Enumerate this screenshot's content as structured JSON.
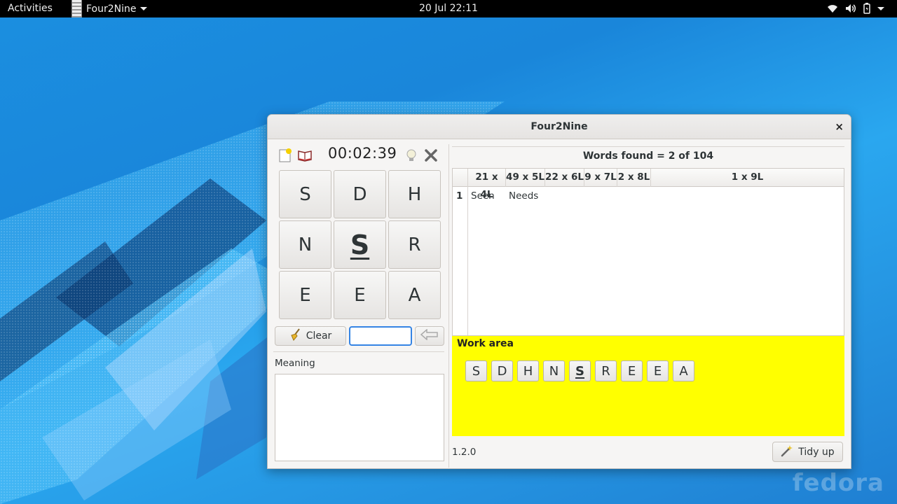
{
  "topbar": {
    "activities": "Activities",
    "app_name": "Four2Nine",
    "clock": "20 Jul  22:11",
    "tray": [
      "wifi-icon",
      "volume-icon",
      "battery-icon",
      "power-menu-caret"
    ]
  },
  "desktop": {
    "brand": "fedora"
  },
  "window": {
    "title": "Four2Nine",
    "close": "×",
    "timer": "00:02:39",
    "grid": [
      "S",
      "D",
      "H",
      "N",
      "S",
      "R",
      "E",
      "E",
      "A"
    ],
    "key_letter_index": 4,
    "clear_label": "Clear",
    "word_input_value": "",
    "meaning_label": "Meaning",
    "meaning_text": "",
    "words_found": "Words found = 2 of 104",
    "columns": [
      "",
      "21 x 4L",
      "49 x 5L",
      "22 x 6L",
      "9 x 7L",
      "2 x 8L",
      "1 x 9L"
    ],
    "rows": [
      {
        "num": "1",
        "cells": [
          "Seen",
          "Needs",
          "",
          "",
          "",
          ""
        ]
      }
    ],
    "work_area_label": "Work area",
    "work_tiles": [
      "S",
      "D",
      "H",
      "N",
      "S",
      "R",
      "E",
      "E",
      "A"
    ],
    "version": "1.2.0",
    "tidy_label": "Tidy up"
  },
  "colors": {
    "work_area": "#ffff00",
    "input_focus": "#3584e4",
    "desktop_blue": "#1a86da"
  }
}
